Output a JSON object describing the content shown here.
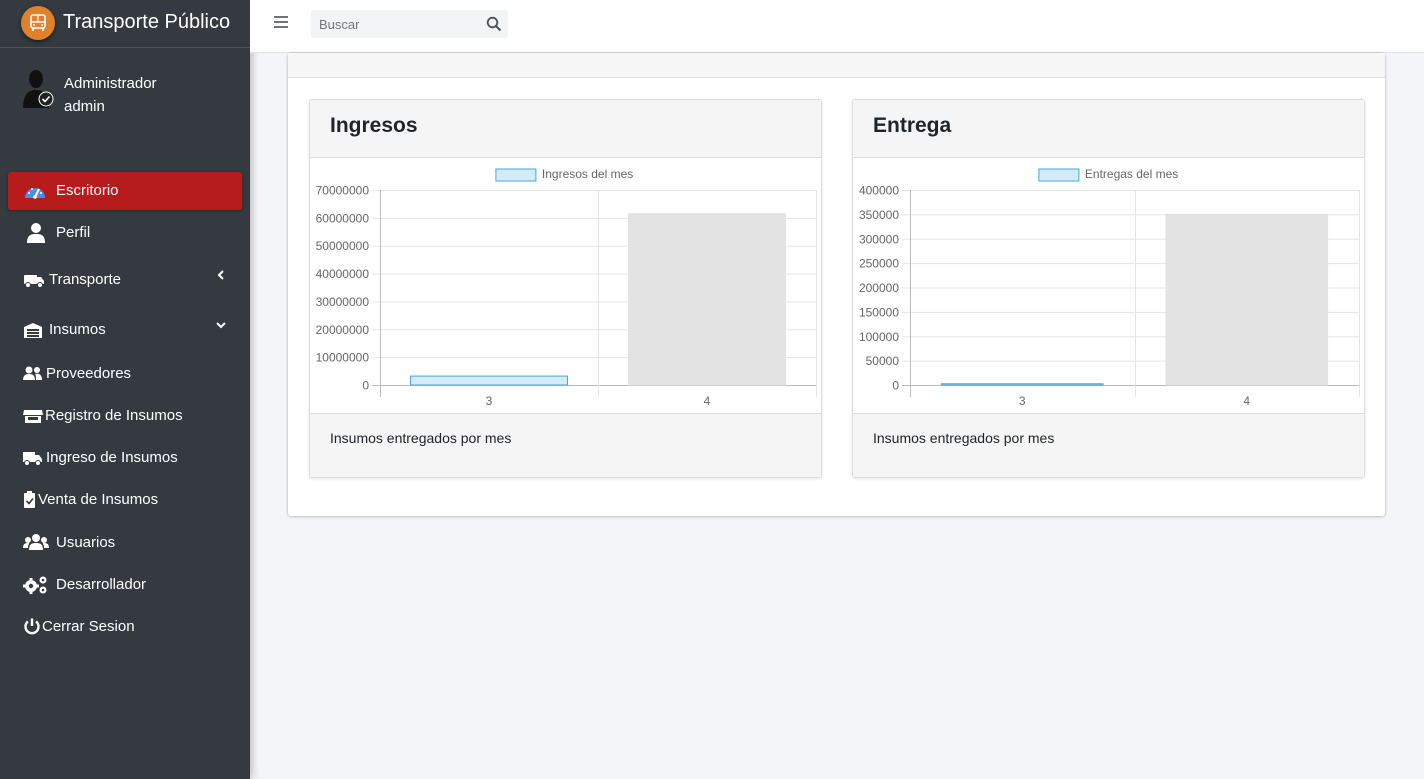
{
  "brand": {
    "title": "Transporte Público",
    "logo_icon": "bus-icon",
    "logo_color": "#e0812c"
  },
  "user": {
    "name": "Administrador",
    "role": "admin"
  },
  "sidebar": {
    "items": [
      {
        "label": "Escritorio",
        "icon": "dashboard-gauge-icon",
        "active": true
      },
      {
        "label": "Perfil",
        "icon": "user-icon"
      },
      {
        "label": "Transporte",
        "icon": "truck-icon",
        "caret": "chevron-left-icon"
      },
      {
        "label": "Insumos",
        "icon": "warehouse-icon",
        "caret": "chevron-down-icon"
      },
      {
        "label": "Proveedores",
        "icon": "user-friends-icon"
      },
      {
        "label": "Registro de Insumos",
        "icon": "store-icon"
      },
      {
        "label": "Ingreso de Insumos",
        "icon": "delivery-truck-icon"
      },
      {
        "label": "Venta de Insumos",
        "icon": "clipboard-check-icon"
      },
      {
        "label": "Usuarios",
        "icon": "users-icon"
      },
      {
        "label": "Desarrollador",
        "icon": "cogs-icon"
      },
      {
        "label": "Cerrar Sesion",
        "icon": "power-icon"
      }
    ],
    "active_color": "#b71c1c"
  },
  "topbar": {
    "search_placeholder": "Buscar"
  },
  "cards": [
    {
      "title": "Ingresos",
      "footer": "Insumos entregados por mes"
    },
    {
      "title": "Entrega",
      "footer": "Insumos entregados por mes"
    }
  ],
  "chart_data": [
    {
      "type": "bar",
      "categories": [
        "3",
        "4"
      ],
      "series": [
        {
          "name": "Ingresos del mes",
          "values": [
            3200000,
            61500000
          ]
        }
      ],
      "ylim": [
        0,
        70000000
      ],
      "yticks": [
        "0",
        "10000000",
        "20000000",
        "30000000",
        "40000000",
        "50000000",
        "60000000",
        "70000000"
      ],
      "bar_colors": [
        "#d2ecf9",
        "#e3e3e3"
      ],
      "bar_borders": [
        "#4aa3df",
        "#e3e3e3"
      ],
      "grid": true,
      "legend": "top"
    },
    {
      "type": "bar",
      "categories": [
        "3",
        "4"
      ],
      "series": [
        {
          "name": "Entregas del mes",
          "values": [
            2500,
            350000
          ]
        }
      ],
      "ylim": [
        0,
        400000
      ],
      "yticks": [
        "0",
        "50000",
        "100000",
        "150000",
        "200000",
        "250000",
        "300000",
        "350000",
        "400000"
      ],
      "bar_colors": [
        "#d2ecf9",
        "#e3e3e3"
      ],
      "bar_borders": [
        "#4aa3df",
        "#e3e3e3"
      ],
      "grid": true,
      "legend": "top"
    }
  ]
}
